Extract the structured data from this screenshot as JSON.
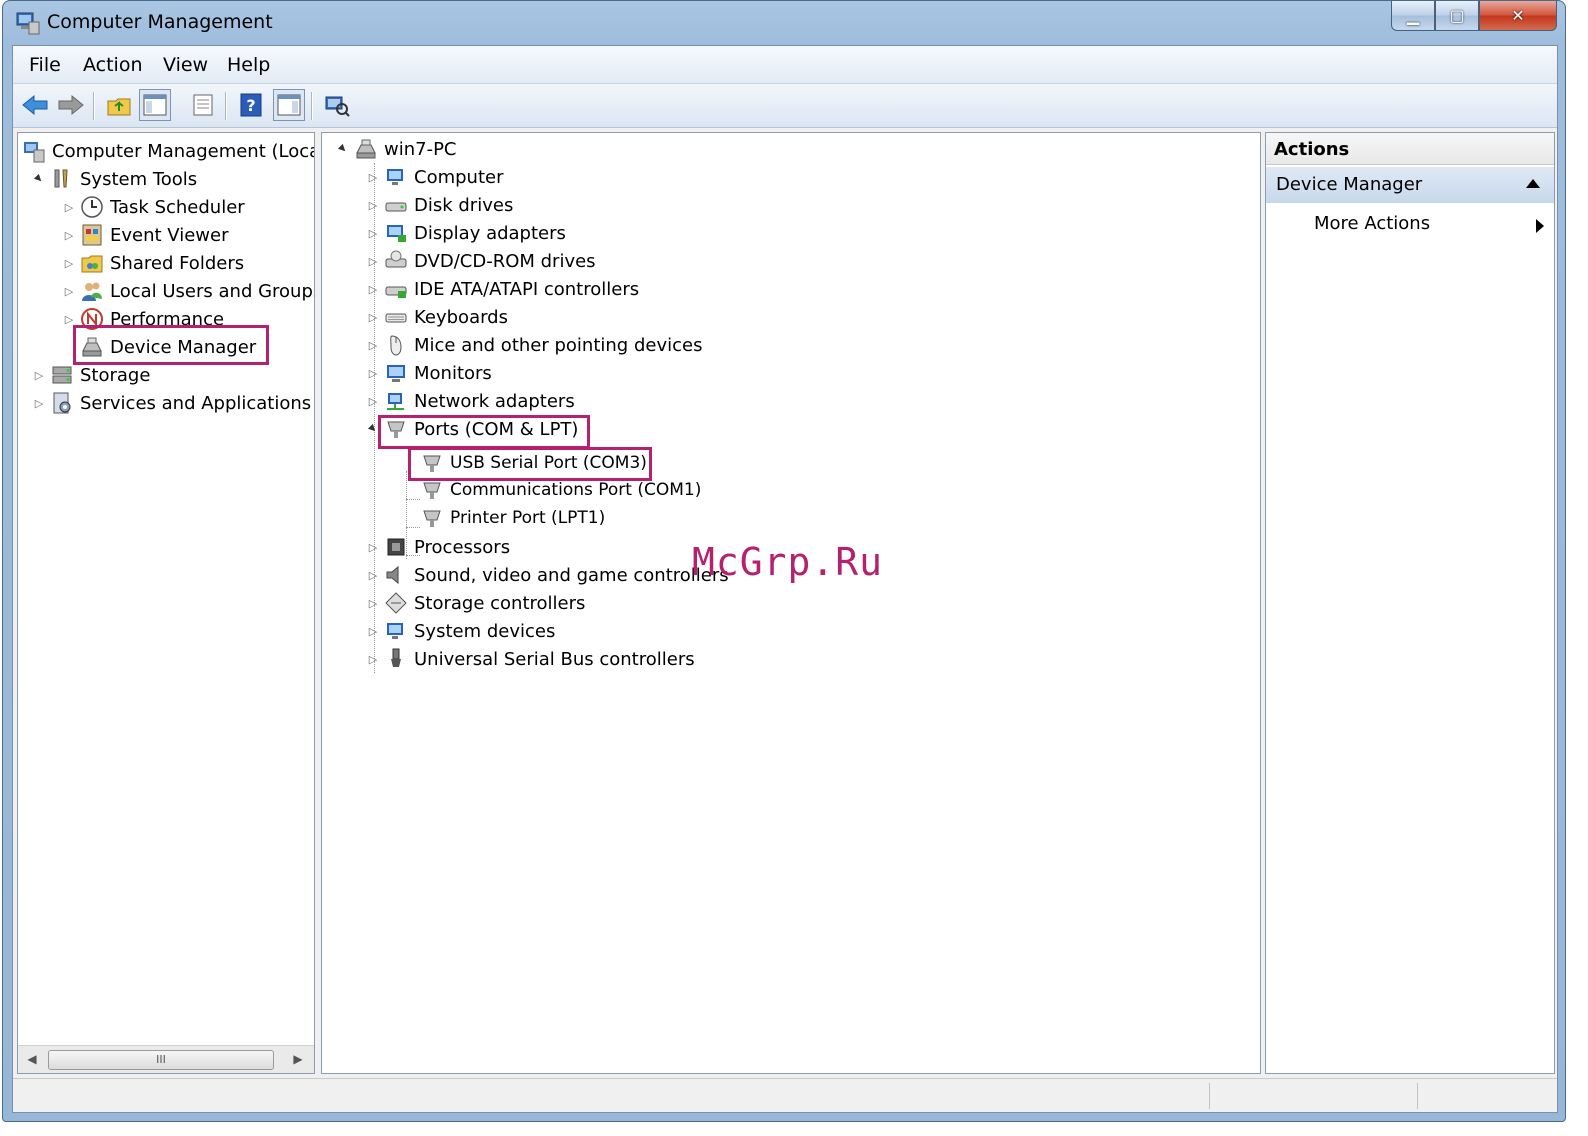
{
  "window": {
    "title": "Computer Management"
  },
  "menu": [
    "File",
    "Action",
    "View",
    "Help"
  ],
  "left_tree": [
    {
      "label": "Computer Management (Local",
      "expander": "",
      "icon": "computer-management-icon"
    },
    {
      "label": "System Tools",
      "expander": "▲",
      "icon": "system-tools-icon"
    },
    {
      "label": "Task Scheduler",
      "expander": "▷",
      "icon": "task-scheduler-icon"
    },
    {
      "label": "Event Viewer",
      "expander": "▷",
      "icon": "event-viewer-icon"
    },
    {
      "label": "Shared Folders",
      "expander": "▷",
      "icon": "shared-folders-icon"
    },
    {
      "label": "Local Users and Groups",
      "expander": "▷",
      "icon": "local-users-icon"
    },
    {
      "label": "Performance",
      "expander": "▷",
      "icon": "performance-icon"
    },
    {
      "label": "Device Manager",
      "expander": "",
      "icon": "device-manager-icon"
    },
    {
      "label": "Storage",
      "expander": "▷",
      "icon": "storage-icon"
    },
    {
      "label": "Services and Applications",
      "expander": "▷",
      "icon": "services-icon"
    }
  ],
  "device_tree": {
    "root": "win7-PC",
    "categories": [
      "Computer",
      "Disk drives",
      "Display adapters",
      "DVD/CD-ROM drives",
      "IDE ATA/ATAPI controllers",
      "Keyboards",
      "Mice and other pointing devices",
      "Monitors",
      "Network adapters",
      "Ports (COM & LPT)",
      "Processors",
      "Sound, video and game controllers",
      "Storage controllers",
      "System devices",
      "Universal Serial Bus controllers"
    ],
    "ports_children": [
      "USB Serial Port (COM3)",
      "Communications Port (COM1)",
      "Printer Port (LPT1)"
    ]
  },
  "actions": {
    "header": "Actions",
    "group": "Device Manager",
    "more": "More Actions"
  },
  "scrollbar": {
    "thumb_label": "III"
  },
  "watermark": "McGrp.Ru",
  "colors": {
    "highlight": "#b4216f"
  }
}
